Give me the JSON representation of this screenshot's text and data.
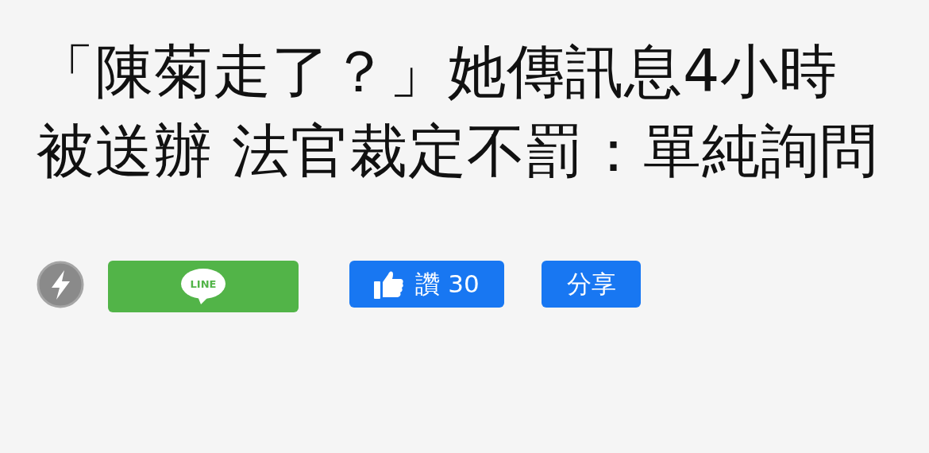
{
  "headline": "「陳菊走了？」她傳訊息4小時被送辦 法官裁定不罰：單純詢問",
  "actions": [
    {
      "kind": "line",
      "label": "LINE"
    },
    {
      "kind": "like",
      "label": "讚 30"
    },
    {
      "kind": "share",
      "label": "分享"
    }
  ]
}
